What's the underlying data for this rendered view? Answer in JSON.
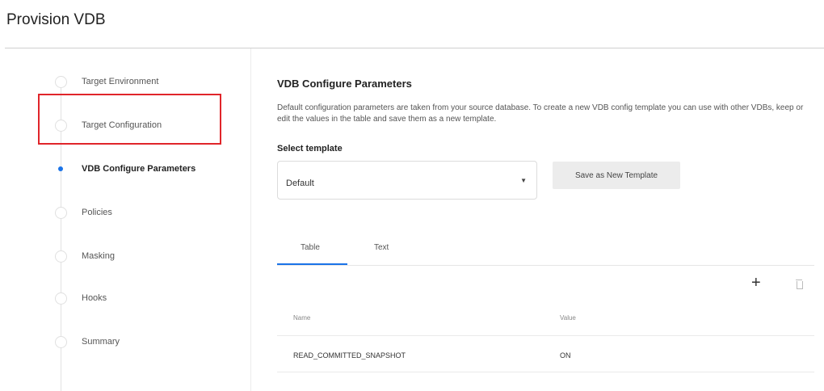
{
  "page": {
    "title": "Provision VDB"
  },
  "stepper": {
    "steps": [
      {
        "label": "Target Environment",
        "active": false
      },
      {
        "label": "Target Configuration",
        "active": false
      },
      {
        "label": "VDB Configure Parameters",
        "active": true
      },
      {
        "label": "Policies",
        "active": false
      },
      {
        "label": "Masking",
        "active": false
      },
      {
        "label": "Hooks",
        "active": false
      },
      {
        "label": "Summary",
        "active": false
      }
    ]
  },
  "main": {
    "title": "VDB Configure Parameters",
    "description": "Default configuration parameters are taken from your source database. To create a new VDB config template you can use with other VDBs, keep or edit the values in the table and save them as a new template.",
    "select_label": "Select template",
    "select_value": "Default",
    "save_button": "Save as New Template",
    "tabs": [
      {
        "label": "Table",
        "active": true
      },
      {
        "label": "Text",
        "active": false
      }
    ],
    "table": {
      "columns": [
        "Name",
        "Value"
      ],
      "rows": [
        {
          "name": "READ_COMMITTED_SNAPSHOT",
          "value": "ON"
        }
      ]
    },
    "icons": {
      "add": "plus-icon",
      "delete": "trash-icon"
    }
  },
  "colors": {
    "accent": "#1a73e8",
    "highlight": "#e0252a"
  }
}
